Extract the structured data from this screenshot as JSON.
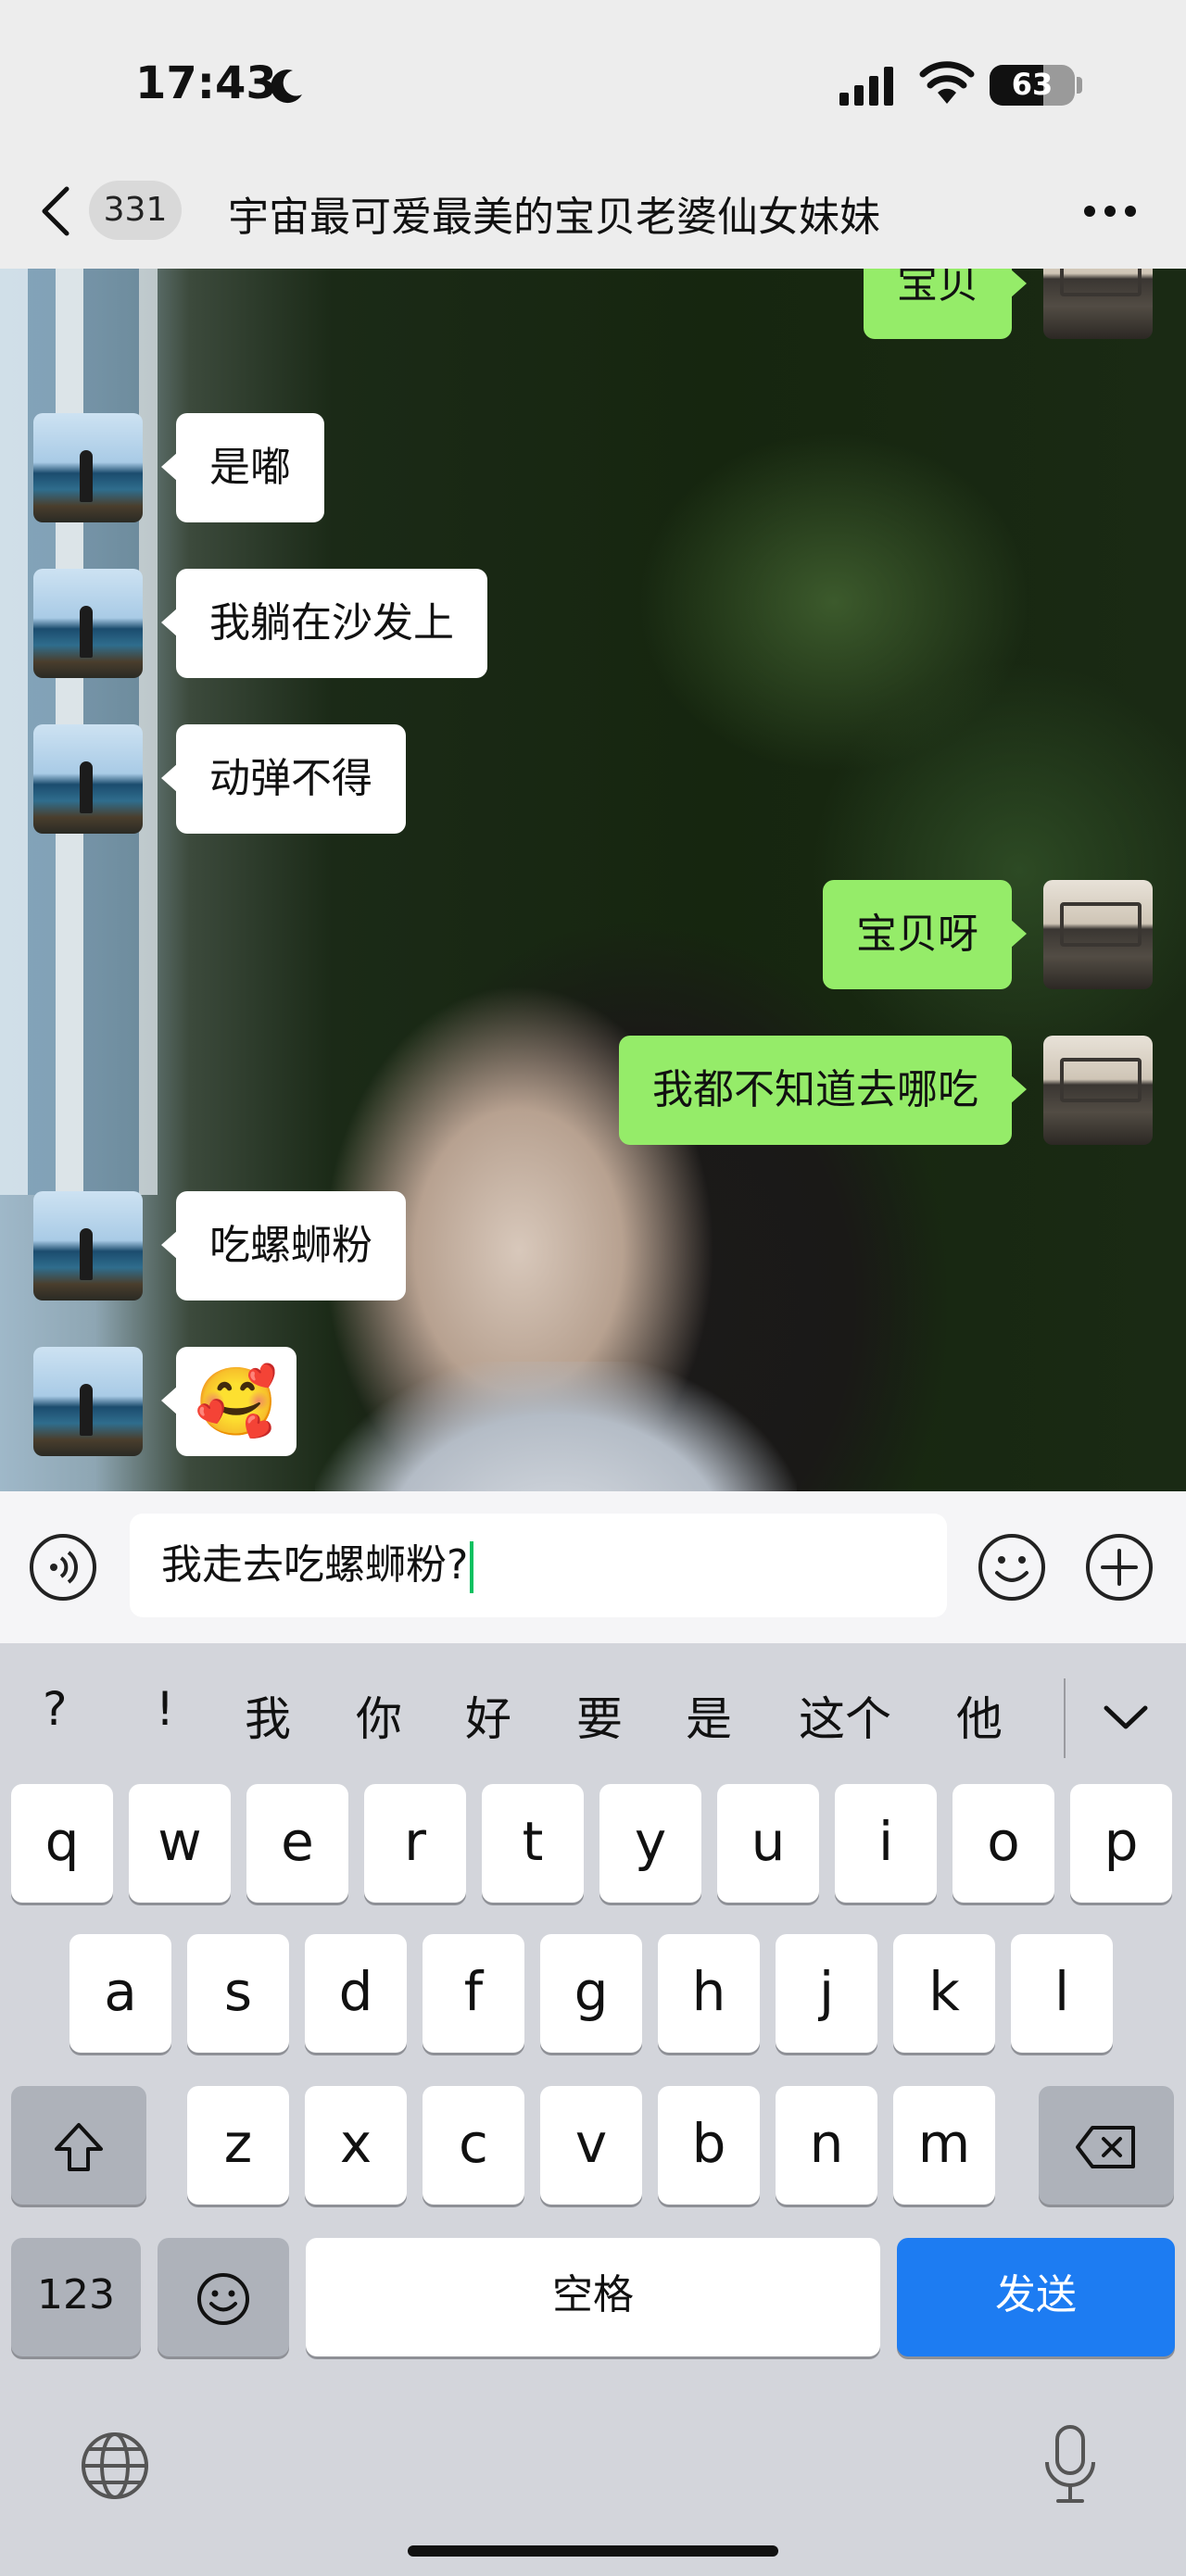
{
  "status_bar": {
    "time": "17:43",
    "battery": "63",
    "battery_level": 0.63
  },
  "header": {
    "unread_count": "331",
    "title": "宇宙最可爱最美的宝贝老婆仙女妹妹"
  },
  "messages": [
    {
      "side": "right",
      "text": "宝贝"
    },
    {
      "side": "left",
      "text": "是嘟"
    },
    {
      "side": "left",
      "text": "我躺在沙发上"
    },
    {
      "side": "left",
      "text": "动弹不得"
    },
    {
      "side": "right",
      "text": "宝贝呀"
    },
    {
      "side": "right",
      "text": "我都不知道去哪吃"
    },
    {
      "side": "left",
      "text": "吃螺蛳粉"
    },
    {
      "side": "left",
      "text": "🥰"
    }
  ],
  "input": {
    "value": "我走去吃螺蛳粉?"
  },
  "candidates": [
    "?",
    "!",
    "我",
    "你",
    "好",
    "要",
    "是",
    "这个",
    "他"
  ],
  "keyboard": {
    "row1": [
      "q",
      "w",
      "e",
      "r",
      "t",
      "y",
      "u",
      "i",
      "o",
      "p"
    ],
    "row2": [
      "a",
      "s",
      "d",
      "f",
      "g",
      "h",
      "j",
      "k",
      "l"
    ],
    "row3": [
      "z",
      "x",
      "c",
      "v",
      "b",
      "n",
      "m"
    ],
    "num_label": "123",
    "space_label": "空格",
    "send_label": "发送"
  },
  "colors": {
    "bubble_mine": "#95ec69",
    "bubble_theirs": "#ffffff",
    "send_key": "#1d7cf2"
  }
}
